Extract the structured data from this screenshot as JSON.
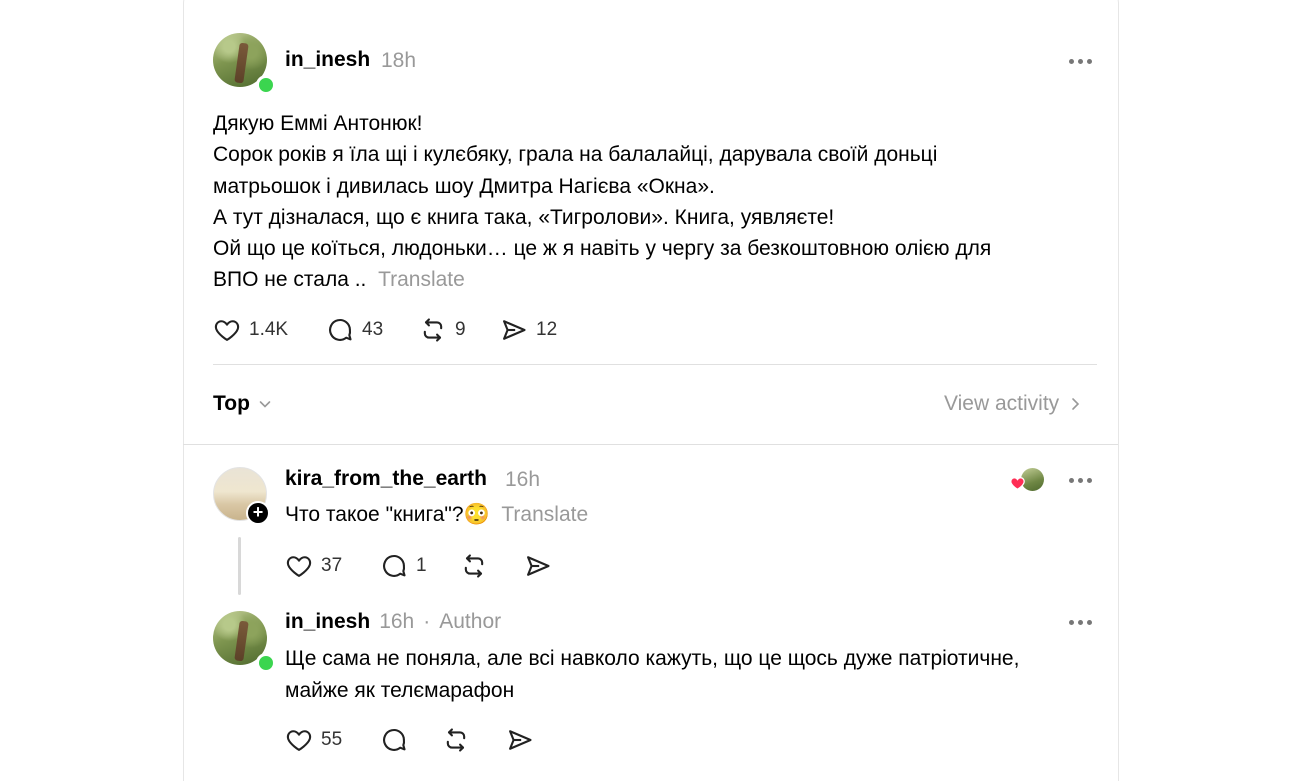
{
  "post": {
    "username": "in_inesh",
    "time": "18h",
    "lines": [
      "Дякую Еммі Антонюк!",
      "Сорок років я їла щі і кулєбяку, грала на балалайці, дарувала своїй доньці",
      "матрьошок і дивилась шоу Дмитра Нагієва «Окна».",
      "А тут дізналася, що є книга така, «Тигролови». Книга, уявляєте!",
      "Ой що це коїться, людоньки… це ж я навіть у чергу за безкоштовною олією для",
      "ВПО не стала .."
    ],
    "translate": "Translate",
    "likes": "1.4K",
    "replies": "43",
    "reposts": "9",
    "shares": "12"
  },
  "sort": {
    "label": "Top",
    "view_activity": "View activity"
  },
  "comments": [
    {
      "username": "kira_from_the_earth",
      "time": "16h",
      "text": "Что такое \"книга\"?😳",
      "translate": "Translate",
      "likes": "37",
      "replies": "1"
    },
    {
      "username": "in_inesh",
      "time": "16h",
      "separator": "·",
      "author_label": "Author",
      "lines": [
        "Ще сама не поняла, але всі навколо кажуть, що це щось дуже патріотичне,",
        "майже як телємарафон"
      ],
      "likes": "55"
    }
  ],
  "icons": {
    "like": "heart-icon",
    "reply": "comment-icon",
    "repost": "repost-icon",
    "share": "send-icon",
    "more": "more-dots-icon"
  }
}
